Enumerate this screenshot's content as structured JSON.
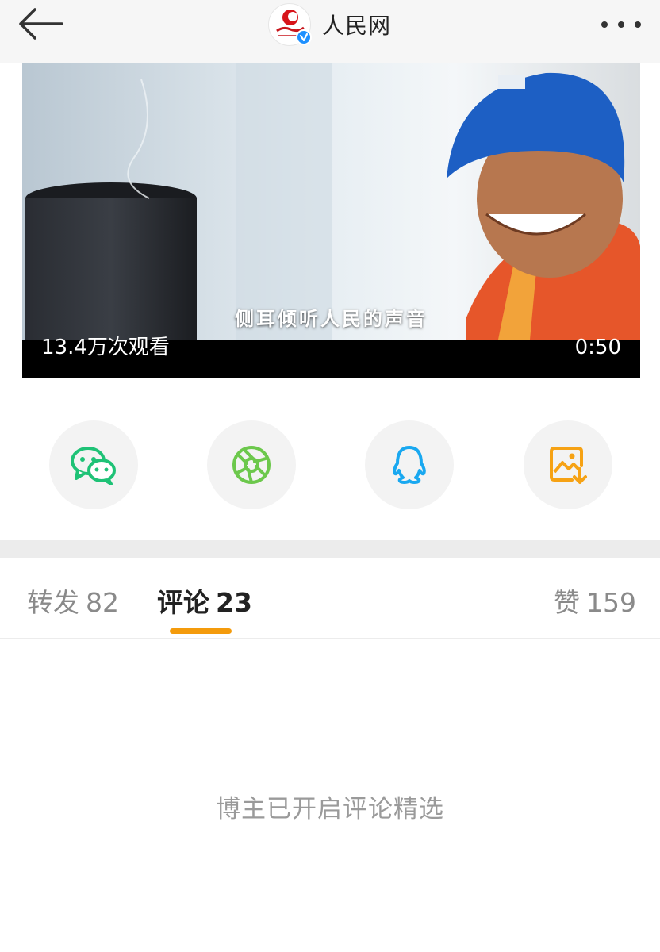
{
  "header": {
    "account_name": "人民网",
    "logo_text": "人民网 people.cn",
    "back_icon": "back-arrow-icon",
    "more_icon": "more-dots-icon",
    "verified_icon": "verified-badge-icon"
  },
  "video": {
    "subtitle": "侧耳倾听人民的声音",
    "views": "13.4万次观看",
    "duration": "0:50"
  },
  "share": {
    "items": [
      {
        "name": "wechat",
        "icon": "wechat-icon",
        "color": "#1ec276"
      },
      {
        "name": "moments",
        "icon": "moments-icon",
        "color": "#6cc84c"
      },
      {
        "name": "qq",
        "icon": "qq-icon",
        "color": "#19a8f0"
      },
      {
        "name": "save-image",
        "icon": "save-image-icon",
        "color": "#f6a214"
      }
    ]
  },
  "tabs": [
    {
      "label": "转发",
      "count": "82",
      "active": false
    },
    {
      "label": "评论",
      "count": "23",
      "active": true
    },
    {
      "label": "赞",
      "count": "159",
      "active": false
    }
  ],
  "comments": {
    "notice": "博主已开启评论精选"
  },
  "colors": {
    "accent": "#f49b0c",
    "brand_red": "#d7141a",
    "verified": "#1e90ff"
  }
}
